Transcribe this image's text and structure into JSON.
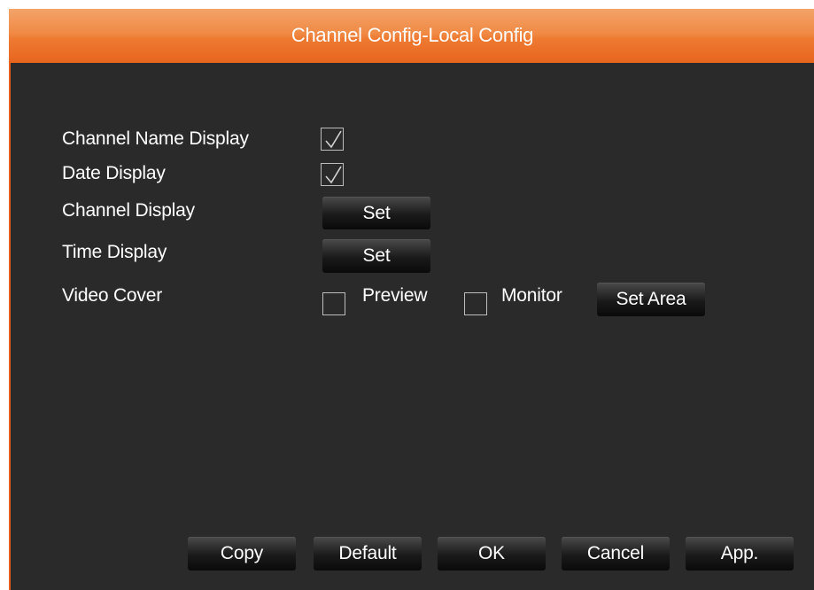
{
  "window": {
    "title": "Channel Config-Local Config"
  },
  "settings": {
    "channel_name_display": {
      "label": "Channel Name Display",
      "checked": true
    },
    "date_display": {
      "label": "Date Display",
      "checked": true
    },
    "channel_display": {
      "label": "Channel Display",
      "button_label": "Set"
    },
    "time_display": {
      "label": "Time Display",
      "button_label": "Set"
    },
    "video_cover": {
      "label": "Video Cover",
      "preview_label": "Preview",
      "preview_checked": false,
      "monitor_label": "Monitor",
      "monitor_checked": false,
      "set_area_label": "Set Area"
    }
  },
  "footer": {
    "copy_label": "Copy",
    "default_label": "Default",
    "ok_label": "OK",
    "cancel_label": "Cancel",
    "apply_label": "App."
  },
  "colors": {
    "title_bar": "#ee7a32",
    "panel_background": "#2a2a2a",
    "text": "#ffffff"
  }
}
